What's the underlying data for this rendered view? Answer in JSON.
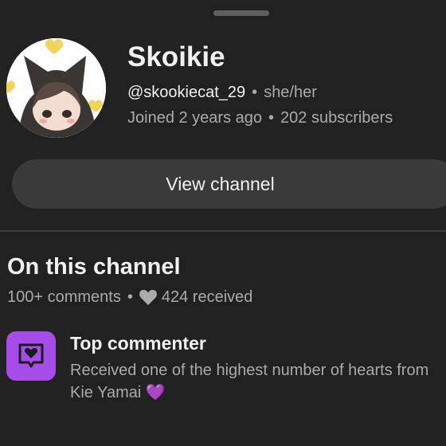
{
  "channel": {
    "name": "Skoikie",
    "handle": "@skookiecat_29",
    "pronouns": "she/her",
    "joined": "Joined 2 years ago",
    "subscribers": "202 subscribers",
    "separator": "•",
    "avatar_icon": "cat-girl-avatar-icon"
  },
  "actions": {
    "view_channel_label": "View channel"
  },
  "on_channel": {
    "title": "On this channel",
    "comments": "100+ comments",
    "separator": "•",
    "hearts": "424 received"
  },
  "badge": {
    "icon": "heart-comment-icon",
    "title": "Top commenter",
    "description_line1": "Received one of the highest number of hearts from",
    "description_line2": "Kie Yamai",
    "emoji": "💜"
  },
  "colors": {
    "background": "#212121",
    "button": "#3a3a3a",
    "accent_purple": "#a64ce8",
    "muted_text": "#aaaaaa"
  }
}
